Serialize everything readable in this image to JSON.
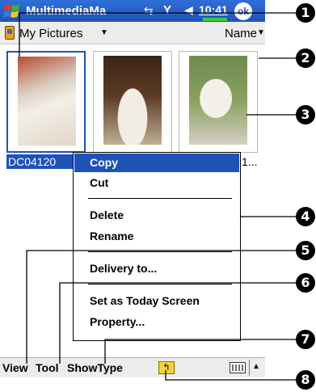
{
  "titlebar": {
    "app_title": "MultimediaMa",
    "conn_icon": "⇆",
    "signal_icon": "Y",
    "volume_icon": "◀",
    "clock": "10:41",
    "ok_label": "ok"
  },
  "folderbar": {
    "folder_name": "My Pictures",
    "sort_label": "Name"
  },
  "files": {
    "selected_name": "DC04120",
    "third_name_tail": "1..."
  },
  "menu": {
    "items": [
      "Copy",
      "Cut",
      "Delete",
      "Rename",
      "Delivery to...",
      "Set as Today Screen",
      "Property..."
    ]
  },
  "bottombar": {
    "view": "View",
    "tool": "Tool",
    "showtype": "ShowType"
  },
  "callouts": [
    "1",
    "2",
    "3",
    "4",
    "5",
    "6",
    "7",
    "8"
  ],
  "colors": {
    "title_blue": "#1f52b6",
    "highlight": "#1f52b6",
    "battery": "#35d035"
  }
}
